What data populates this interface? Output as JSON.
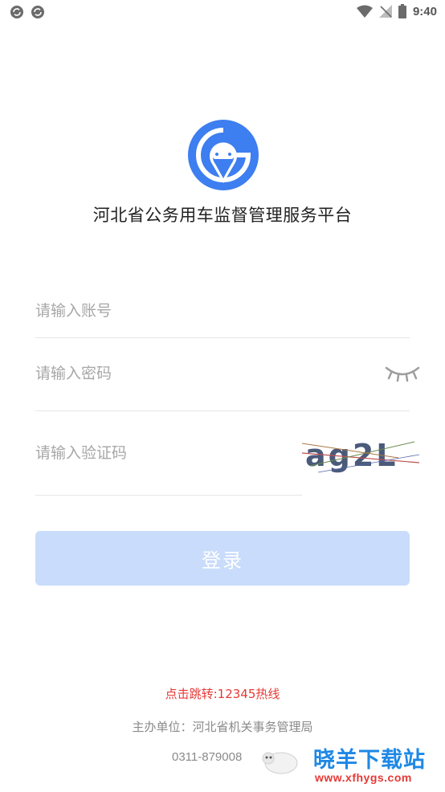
{
  "status_bar": {
    "time": "9:40",
    "left_icons": [
      "sync-icon",
      "sync-icon"
    ],
    "right_icons": [
      "wifi-icon",
      "no-signal-icon",
      "battery-icon"
    ]
  },
  "app": {
    "title": "河北省公务用车监督管理服务平台",
    "logo_icon": "car-location-logo-icon",
    "brand_color": "#3d7ef0"
  },
  "login_form": {
    "account_placeholder": "请输入账号",
    "password_placeholder": "请输入密码",
    "captcha_placeholder": "请输入验证码",
    "captcha_text": "ag2L",
    "password_toggle_icon": "eye-closed-icon",
    "submit_label": "登录",
    "submit_color": "#c9dcfb"
  },
  "footer": {
    "hotline_link": "点击跳转:12345热线",
    "sponsor": "主办单位：河北省机关事务管理局",
    "phone": "0311-879008"
  },
  "watermark": {
    "title": "晓羊下载站",
    "url": "www.xfhygs.com"
  }
}
